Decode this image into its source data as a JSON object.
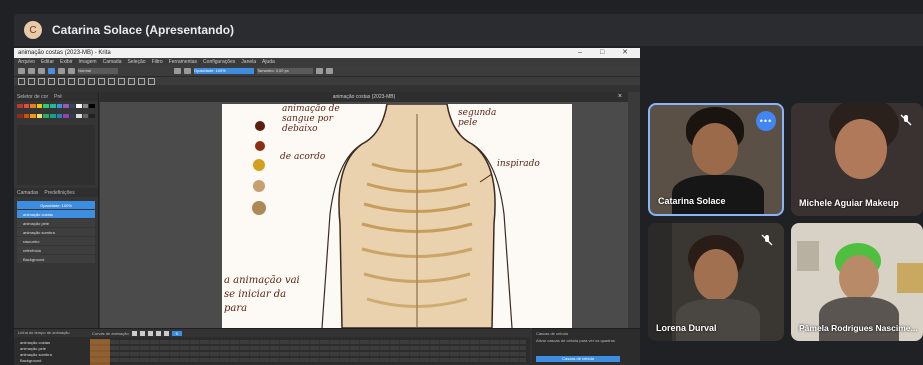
{
  "meeting": {
    "presenter_title": "Catarina Solace (Apresentando)",
    "presenter_initial": "C"
  },
  "krita": {
    "window_title": "animação costas (2023-MB) - Krita",
    "window_controls": "– □ ✕",
    "menus": [
      "Arquivo",
      "Editar",
      "Exibir",
      "Imagem",
      "Camada",
      "Seleção",
      "Filtro",
      "Ferramentas",
      "Configurações",
      "Janela",
      "Ajuda"
    ],
    "blend_mode": "Normal",
    "brush_size": "Opacidade: 100%",
    "size_field": "Tamanho: 3,00 px",
    "document_tab": "animação costas (2023-MB)",
    "docker_tabs": [
      "Seletor de cor",
      "Pré"
    ],
    "layer_tabs": [
      "Camadas",
      "Predefinições"
    ],
    "opacity_label": "Opacidade: 100%",
    "layers": [
      {
        "name": "animação costas",
        "active": true
      },
      {
        "name": "animação pele",
        "active": false
      },
      {
        "name": "animação sombra",
        "active": false
      },
      {
        "name": "rascunho",
        "active": false
      },
      {
        "name": "referência",
        "active": false
      },
      {
        "name": "Background",
        "active": false
      }
    ],
    "timeline_title": "Linha do tempo de animação",
    "timeline_subtitle": "Curvas de animação",
    "timeline_rows": [
      "animação costas",
      "animação pele",
      "animação sombra",
      "Background"
    ],
    "frame_field": "0",
    "onion_title": "Cascas de cebola",
    "onion_text": "Ativar cascas de cebola para ver os quadros",
    "onion_button": "Cascas de cebola"
  },
  "drawing": {
    "annotations": [
      "animação de sangue por debaixo",
      "de acordo",
      "segunda pele",
      "inspirado",
      "a animação vai se iniciar da para"
    ],
    "swatches": [
      "#5a1f10",
      "#8a3010",
      "#d4a020",
      "#c8a070",
      "#b08858"
    ]
  },
  "participants": [
    {
      "name": "Catarina Solace",
      "speaking": true
    },
    {
      "name": "Michele Aguiar Makeup",
      "speaking": false
    },
    {
      "name": "Lorena Durval",
      "speaking": false
    },
    {
      "name": "Pâmela Rodrigues Nascime...",
      "speaking": false
    }
  ],
  "colors": {
    "meet_bg": "#202124",
    "speaking_border": "#8ab4f8",
    "krita_accent": "#3d8ee0"
  }
}
